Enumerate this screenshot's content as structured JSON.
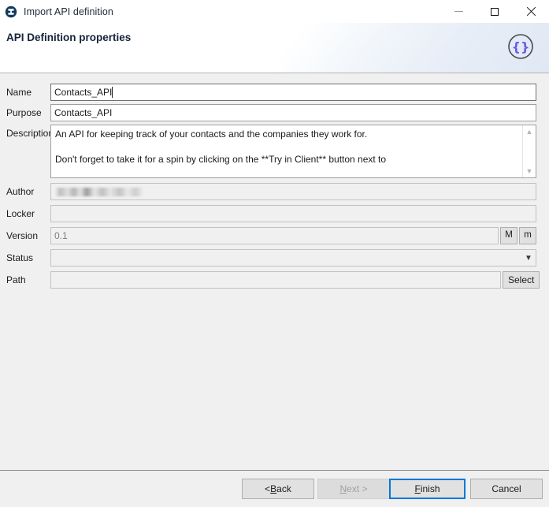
{
  "window": {
    "title": "Import API definition",
    "icon": "app-circle-icon",
    "controls": {
      "minimize": "minimize-icon",
      "maximize": "maximize-icon",
      "close": "close-icon"
    }
  },
  "header": {
    "title": "API Definition properties",
    "logo_icon": "json-braces-circle-icon",
    "logo_glyph": "{}",
    "logo_color": "#6c5ce7"
  },
  "form": {
    "name": {
      "label": "Name",
      "value": "Contacts_API",
      "placeholder": ""
    },
    "purpose": {
      "label": "Purpose",
      "value": "Contacts_API",
      "placeholder": ""
    },
    "description": {
      "label": "Description",
      "value": "An API for keeping track of your contacts and the companies they work for.\n\nDon't forget to take it for a spin by clicking on the **Try in Client** button next to",
      "scroll_up_icon": "chevron-up-icon",
      "scroll_down_icon": "chevron-down-icon"
    },
    "author": {
      "label": "Author",
      "value": "",
      "redacted": true
    },
    "locker": {
      "label": "Locker",
      "value": ""
    },
    "version": {
      "label": "Version",
      "value": "0.1",
      "major_button": "M",
      "minor_button": "m"
    },
    "status": {
      "label": "Status",
      "value": "",
      "arrow_icon": "chevron-down-icon",
      "options": []
    },
    "path": {
      "label": "Path",
      "value": "",
      "select_button": "Select"
    }
  },
  "footer": {
    "back": {
      "prefix": "< ",
      "mnemonic": "B",
      "suffix": "ack"
    },
    "next": {
      "prefix": "",
      "mnemonic": "N",
      "suffix": "ext >"
    },
    "finish": {
      "prefix": "",
      "mnemonic": "F",
      "suffix": "inish"
    },
    "cancel": {
      "prefix": "",
      "mnemonic": "",
      "suffix": "Cancel"
    }
  },
  "colors": {
    "accent": "#0078d7",
    "titlebar_icon": "#14395e",
    "logo_purple": "#6c5ce7"
  }
}
